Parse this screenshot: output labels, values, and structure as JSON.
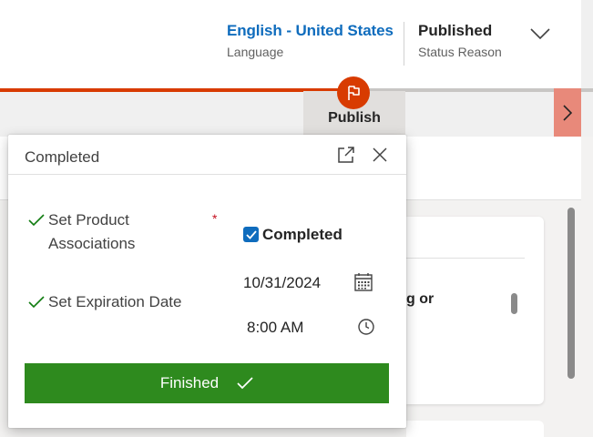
{
  "header": {
    "language": {
      "value": "English - United States",
      "label": "Language"
    },
    "status_reason": {
      "value": "Published",
      "label": "Status Reason"
    }
  },
  "process": {
    "active_stage": "Publish",
    "colors": {
      "active": "#d83b01",
      "next": "#e8897a"
    }
  },
  "background": {
    "card_text": "g or"
  },
  "flyout": {
    "title": "Completed",
    "steps": [
      {
        "label": "Set Product Associations",
        "required": true,
        "required_mark": "*",
        "checkbox_label": "Completed",
        "checked": true
      },
      {
        "label": "Set Expiration Date",
        "date": "10/31/2024",
        "time": "8:00 AM"
      }
    ],
    "finish_label": "Finished",
    "colors": {
      "finish": "#2e8a1e",
      "check": "#107c10"
    }
  },
  "icons": [
    "chevron-down-icon",
    "flag-icon",
    "chevron-right-icon",
    "popout-icon",
    "close-icon",
    "checkmark-icon",
    "calendar-icon",
    "clock-icon"
  ]
}
